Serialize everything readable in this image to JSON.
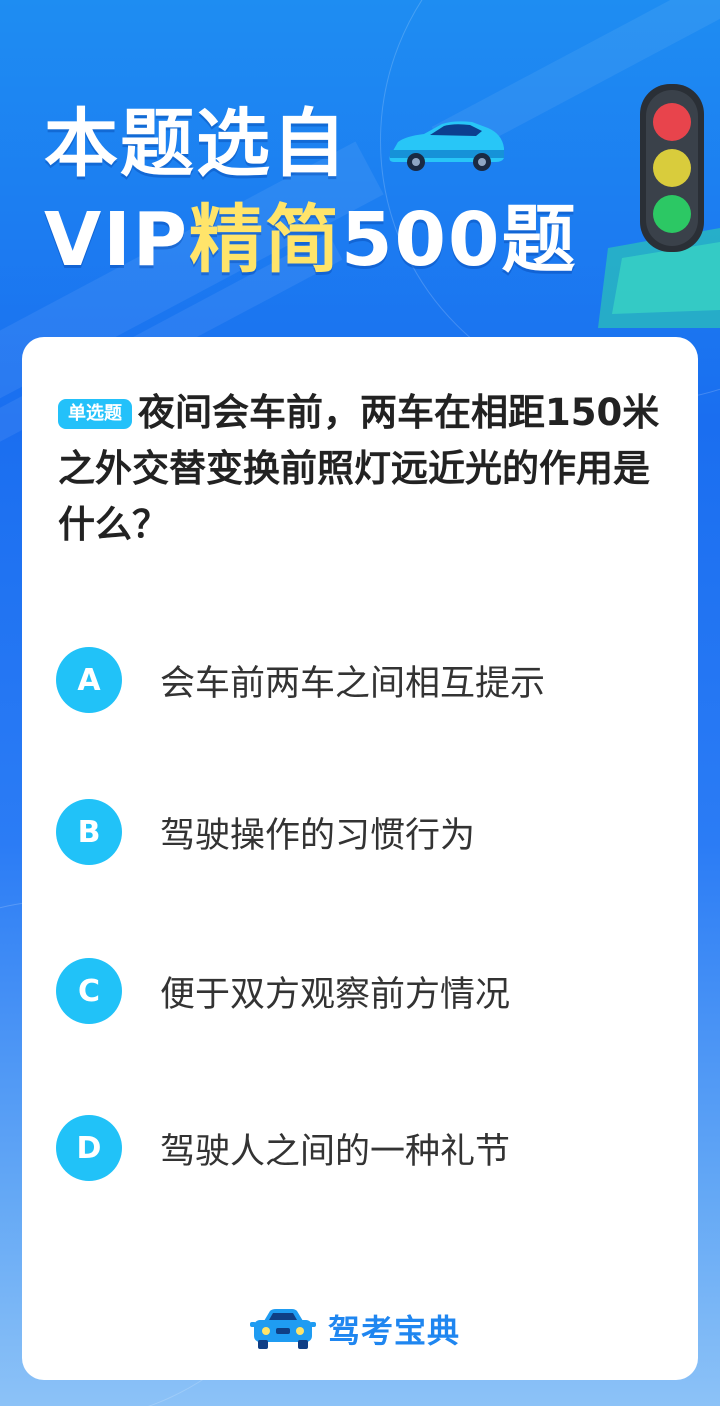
{
  "header": {
    "line1": "本题选自",
    "line2_prefix": "VIP",
    "line2_highlight": "精简",
    "line2_suffix": "500题"
  },
  "question": {
    "type_tag": "单选题",
    "text": "夜间会车前，两车在相距150米之外交替变换前照灯远近光的作用是什么？"
  },
  "options": [
    {
      "letter": "A",
      "text": "会车前两车之间相互提示"
    },
    {
      "letter": "B",
      "text": "驾驶操作的习惯行为"
    },
    {
      "letter": "C",
      "text": "便于双方观察前方情况"
    },
    {
      "letter": "D",
      "text": "驾驶人之间的一种礼节"
    }
  ],
  "brand": {
    "name": "驾考宝典",
    "icon": "car-logo-icon"
  },
  "icons": [
    "car-icon",
    "traffic-light-icon",
    "car-logo-icon"
  ],
  "colors": {
    "accent": "#21c2f8",
    "highlight": "#ffe46a",
    "brand": "#1f86f0",
    "background_top": "#1e8df2",
    "background_bottom": "#8cc2f7"
  }
}
